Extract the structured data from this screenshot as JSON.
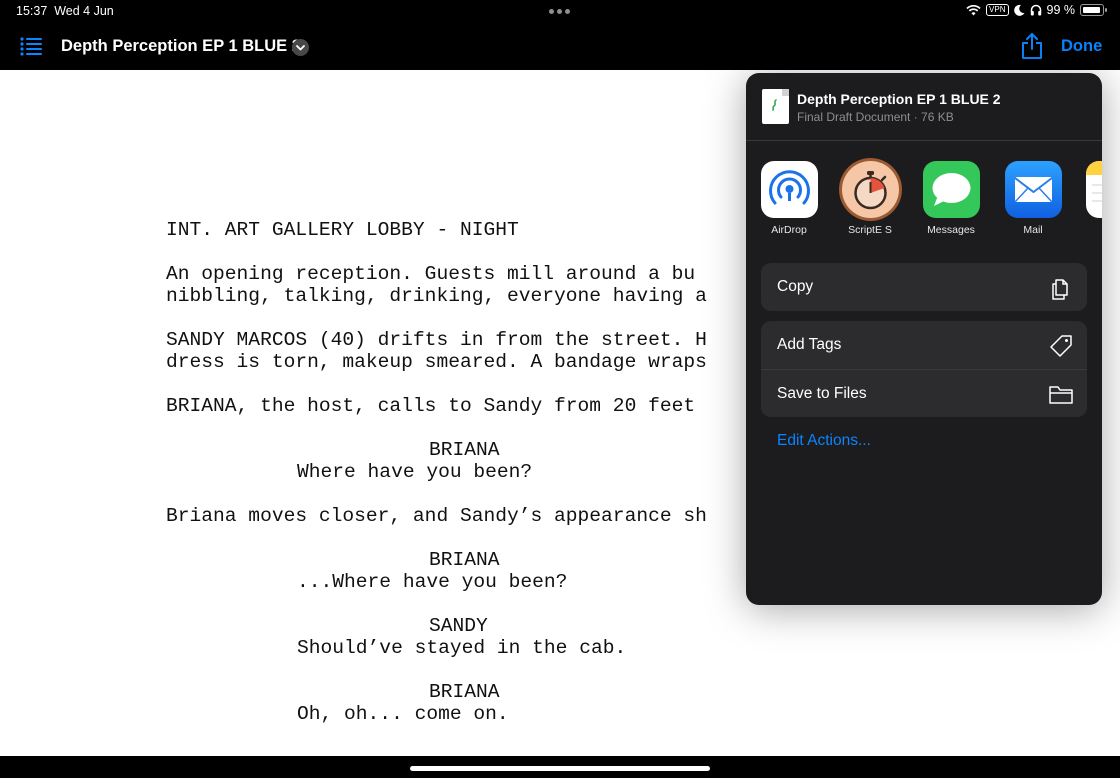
{
  "status_bar": {
    "time": "15:37",
    "date": "Wed 4 Jun",
    "vpn": "VPN",
    "battery": "99 %"
  },
  "nav_bar": {
    "title": "Depth Perception EP 1 BLUE 2",
    "done_label": "Done"
  },
  "script": {
    "lines": [
      {
        "text": "INT. ART GALLERY LOBBY - NIGHT"
      },
      {
        "text": "An opening reception. Guests mill around a bu"
      },
      {
        "text": "nibbling, talking, drinking, everyone having a"
      },
      {
        "text": "SANDY MARCOS (40) drifts in from the street. H"
      },
      {
        "text": "dress is torn, makeup smeared. A bandage wraps"
      },
      {
        "text": "BRIANA, the host, calls to Sandy from 20 feet"
      },
      {
        "text": "BRIANA"
      },
      {
        "text": "Where have you been?"
      },
      {
        "text": "Briana moves closer, and Sandy’s appearance sh"
      },
      {
        "text": "BRIANA"
      },
      {
        "text": "...Where have you been?"
      },
      {
        "text": "SANDY"
      },
      {
        "text": "Should’ve stayed in the cab."
      },
      {
        "text": "BRIANA"
      },
      {
        "text": "Oh, oh... come on."
      }
    ]
  },
  "share_sheet": {
    "file_name": "Depth Perception EP 1 BLUE 2",
    "file_meta": "Final Draft Document · 76 KB",
    "apps": [
      {
        "label": "AirDrop",
        "icon": "airdrop-icon"
      },
      {
        "label": "ScriptE S",
        "icon": "stopwatch-icon"
      },
      {
        "label": "Messages",
        "icon": "messages-icon"
      },
      {
        "label": "Mail",
        "icon": "mail-icon"
      },
      {
        "label": "N",
        "icon": "notes-icon"
      }
    ],
    "actions": {
      "copy": "Copy",
      "add_tags": "Add Tags",
      "save_to_files": "Save to Files"
    },
    "edit_actions": "Edit Actions..."
  },
  "colors": {
    "accent": "#0a84ff",
    "sheet_background": "#1c1c1e",
    "row_background": "#2c2c2e"
  }
}
